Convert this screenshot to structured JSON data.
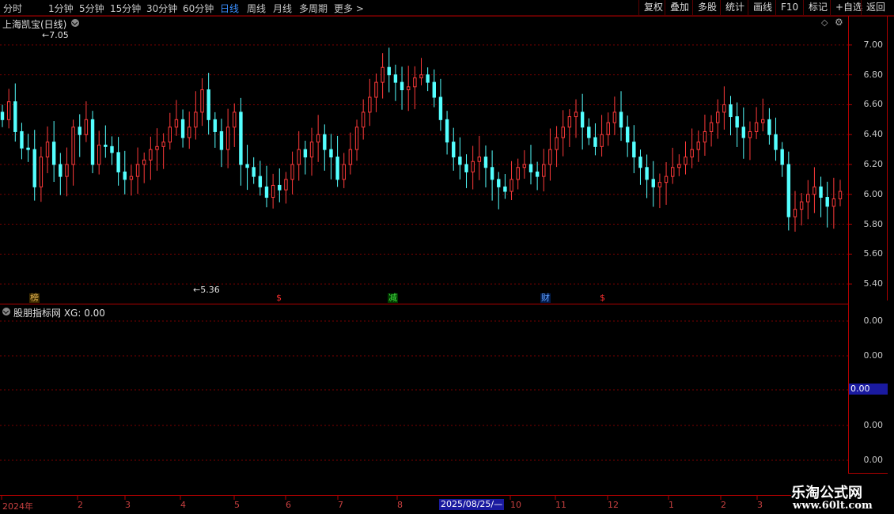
{
  "toolbar": {
    "periods": [
      "分时",
      "1分钟",
      "5分钟",
      "15分钟",
      "30分钟",
      "60分钟",
      "日线",
      "周线",
      "月线",
      "多周期",
      "更多 >"
    ],
    "active_period": "日线",
    "buttons": [
      "复权",
      "叠加",
      "多股",
      "统计",
      "画线",
      "F10",
      "标记",
      "+自选",
      "返回"
    ]
  },
  "main_chart": {
    "title": "上海凯宝(日线)",
    "high_label": "7.05",
    "low_label": "5.36",
    "y_ticks": [
      "7.00",
      "6.80",
      "6.60",
      "6.40",
      "6.20",
      "6.00",
      "5.80",
      "5.60",
      "5.40"
    ],
    "signals": [
      {
        "text": "榜",
        "color": "#e0b050"
      },
      {
        "text": "$",
        "color": "#ff3030"
      },
      {
        "text": "减",
        "color": "#40e040"
      },
      {
        "text": "财",
        "color": "#60a0ff"
      },
      {
        "text": "$",
        "color": "#ff3030"
      }
    ]
  },
  "indicator": {
    "title": "股朋指标网 XG: 0.00",
    "y_ticks": [
      "0.00",
      "0.00",
      "0.00",
      "0.00"
    ],
    "current_value": "0.00"
  },
  "x_axis": {
    "labels": [
      "2024年",
      "2",
      "3",
      "4",
      "5",
      "6",
      "7",
      "8",
      "10",
      "11",
      "12",
      "1",
      "2",
      "3"
    ],
    "cursor_date": "2025/08/25/—"
  },
  "watermark": {
    "line1": "乐淘公式网",
    "line2": "www.60lt.com"
  },
  "colors": {
    "up": "#ff3a3a",
    "down": "#54ffff",
    "grid": "#7a0000",
    "border": "#b00000"
  },
  "chart_data": {
    "type": "candlestick",
    "ylim": [
      5.3,
      7.1
    ],
    "close": [
      6.5,
      6.62,
      6.42,
      6.31,
      6.3,
      6.05,
      6.25,
      6.35,
      6.2,
      6.12,
      6.2,
      6.45,
      6.4,
      6.5,
      6.2,
      6.33,
      6.32,
      6.28,
      6.15,
      6.1,
      6.12,
      6.2,
      6.23,
      6.3,
      6.32,
      6.35,
      6.45,
      6.5,
      6.38,
      6.45,
      6.55,
      6.7,
      6.5,
      6.42,
      6.3,
      6.45,
      6.55,
      6.2,
      6.18,
      6.12,
      6.05,
      5.98,
      6.06,
      6.03,
      6.1,
      6.2,
      6.3,
      6.25,
      6.35,
      6.4,
      6.3,
      6.25,
      6.1,
      6.2,
      6.3,
      6.45,
      6.55,
      6.65,
      6.75,
      6.85,
      6.8,
      6.75,
      6.7,
      6.72,
      6.78,
      6.8,
      6.75,
      6.65,
      6.5,
      6.35,
      6.25,
      6.2,
      6.15,
      6.22,
      6.25,
      6.18,
      6.1,
      6.05,
      6.02,
      6.1,
      6.18,
      6.2,
      6.15,
      6.12,
      6.2,
      6.3,
      6.38,
      6.45,
      6.52,
      6.55,
      6.45,
      6.38,
      6.32,
      6.4,
      6.48,
      6.55,
      6.45,
      6.35,
      6.25,
      6.18,
      6.1,
      6.05,
      6.08,
      6.12,
      6.18,
      6.2,
      6.25,
      6.3,
      6.35,
      6.42,
      6.48,
      6.55,
      6.6,
      6.52,
      6.45,
      6.38,
      6.42,
      6.48,
      6.5,
      6.4,
      6.3,
      6.2,
      5.85,
      5.9,
      5.95,
      6.0,
      6.05,
      5.98,
      5.92,
      5.97,
      6.02
    ],
    "open": [
      6.55,
      6.5,
      6.62,
      6.42,
      6.31,
      6.3,
      6.05,
      6.25,
      6.35,
      6.2,
      6.12,
      6.2,
      6.45,
      6.4,
      6.5,
      6.2,
      6.33,
      6.32,
      6.28,
      6.15,
      6.1,
      6.12,
      6.2,
      6.23,
      6.3,
      6.32,
      6.35,
      6.45,
      6.5,
      6.38,
      6.45,
      6.55,
      6.7,
      6.5,
      6.42,
      6.3,
      6.45,
      6.55,
      6.2,
      6.18,
      6.12,
      6.05,
      5.98,
      6.06,
      6.03,
      6.1,
      6.2,
      6.3,
      6.25,
      6.35,
      6.4,
      6.3,
      6.25,
      6.1,
      6.2,
      6.3,
      6.45,
      6.55,
      6.65,
      6.75,
      6.85,
      6.8,
      6.75,
      6.7,
      6.72,
      6.78,
      6.8,
      6.75,
      6.65,
      6.5,
      6.35,
      6.25,
      6.2,
      6.15,
      6.22,
      6.25,
      6.18,
      6.1,
      6.05,
      6.02,
      6.1,
      6.18,
      6.2,
      6.15,
      6.12,
      6.2,
      6.3,
      6.38,
      6.45,
      6.52,
      6.55,
      6.45,
      6.38,
      6.32,
      6.4,
      6.48,
      6.55,
      6.45,
      6.35,
      6.25,
      6.18,
      6.1,
      6.05,
      6.08,
      6.12,
      6.18,
      6.2,
      6.25,
      6.3,
      6.35,
      6.42,
      6.48,
      6.55,
      6.6,
      6.52,
      6.45,
      6.38,
      6.42,
      6.48,
      6.5,
      6.4,
      6.3,
      6.2,
      5.85,
      5.9,
      5.95,
      6.0,
      6.05,
      5.98,
      5.92,
      5.97
    ]
  }
}
